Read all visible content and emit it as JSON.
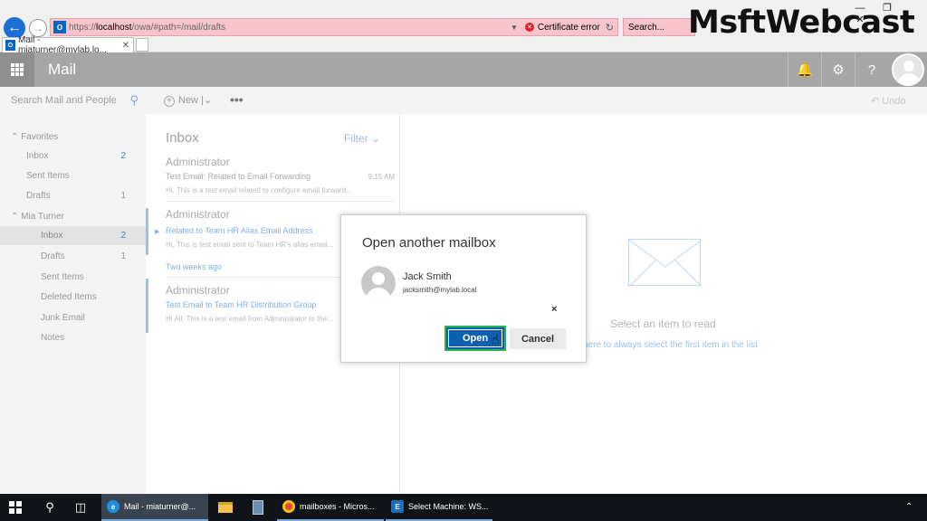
{
  "browser": {
    "url_prefix": "https://",
    "url_host": "localhost",
    "url_path": "/owa/#path=/mail/drafts",
    "cert_error": "Certificate error",
    "search_placeholder": "Search...",
    "tab_title": "Mail - miaturner@mylab.lo...",
    "favicon_letter": "O",
    "window_controls": [
      "—",
      "❐",
      "✕"
    ]
  },
  "watermark": "MsftWebcast",
  "header": {
    "app_title": "Mail",
    "icons": [
      "bell-icon",
      "gear-icon",
      "help-icon"
    ]
  },
  "commandbar": {
    "search_placeholder": "Search Mail and People",
    "new_label": "New",
    "new_dropdown": "|",
    "more": "•••",
    "undo_label": "Undo"
  },
  "folders": {
    "favorites_label": "Favorites",
    "favorites": [
      {
        "name": "Inbox",
        "count": "2"
      },
      {
        "name": "Sent Items",
        "count": ""
      },
      {
        "name": "Drafts",
        "count": "1"
      }
    ],
    "account_label": "Mia Turner",
    "account_folders": [
      {
        "name": "Inbox",
        "count": "2"
      },
      {
        "name": "Drafts",
        "count": "1"
      },
      {
        "name": "Sent Items",
        "count": ""
      },
      {
        "name": "Deleted Items",
        "count": ""
      },
      {
        "name": "Junk Email",
        "count": ""
      },
      {
        "name": "Notes",
        "count": ""
      }
    ]
  },
  "message_list": {
    "title": "Inbox",
    "filter_label": "Filter",
    "group_label": "Two weeks ago",
    "messages": [
      {
        "sender": "Administrator",
        "subject": "Test Email: Related to Email Forwarding",
        "time": "9:15 AM",
        "preview": "Hi, This is a test email related to configure email forward..."
      },
      {
        "sender": "Administrator",
        "subject": "Related to Team HR Alias Email Address",
        "time": "",
        "preview": "Hi, This is test email sent to Team HR's alias email..."
      },
      {
        "sender": "Administrator",
        "subject": "Test Email to Team HR Distribution Group",
        "time": "",
        "preview": "Hi All, This is a test email from Administrator to the..."
      }
    ]
  },
  "reading_pane": {
    "empty_text": "Select an item to read",
    "link_text": "here to always select the first item in the list"
  },
  "dialog": {
    "title": "Open another mailbox",
    "person_name": "Jack Smith",
    "person_email": "jacksmith@mylab.local",
    "remove_glyph": "×",
    "open_label": "Open",
    "cancel_label": "Cancel"
  },
  "taskbar": {
    "apps": [
      {
        "label": "Mail - miaturner@...",
        "active": true
      },
      {
        "label": "mailboxes - Micros..."
      },
      {
        "label": "Select Machine: WS..."
      }
    ]
  },
  "colors": {
    "accent": "#0f5fb0",
    "highlight_border": "#2bb24c",
    "header_gray": "#a6a6a6",
    "address_error": "#f9c5cc"
  }
}
